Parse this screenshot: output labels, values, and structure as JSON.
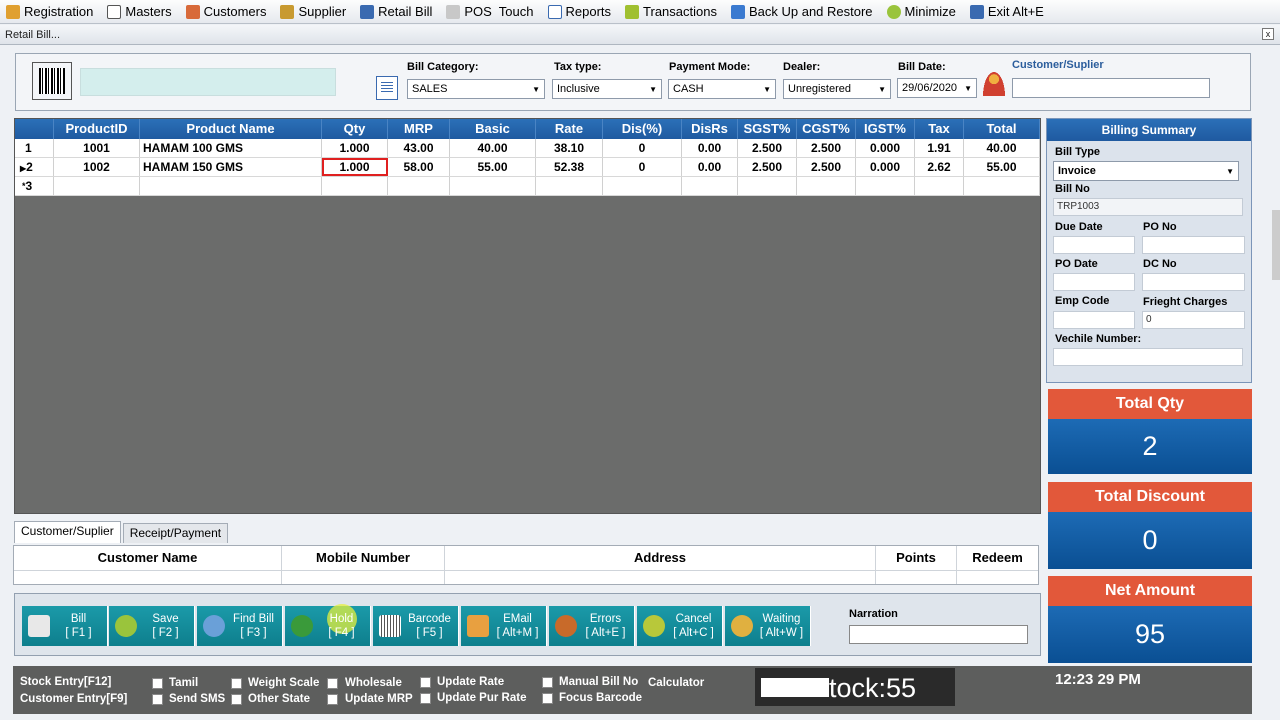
{
  "menu": [
    "Registration",
    "Masters",
    "Customers",
    "Supplier",
    "Retail Bill",
    "POS  Touch",
    "Reports",
    "Transactions",
    "Back Up and Restore",
    "Minimize",
    "Exit Alt+E"
  ],
  "window_title": "Retail Bill...",
  "close_glyph": "x",
  "fields": {
    "bill_category_label": "Bill Category:",
    "bill_category_value": "SALES",
    "tax_type_label": "Tax type:",
    "tax_type_value": "Inclusive",
    "payment_mode_label": "Payment Mode:",
    "payment_mode_value": "CASH",
    "dealer_label": "Dealer:",
    "dealer_value": "Unregistered",
    "bill_date_label": "Bill Date:",
    "bill_date_value": "29/06/2020",
    "customer_label": "Customer/Suplier",
    "customer_value": ""
  },
  "grid": {
    "columns": [
      "ProductID",
      "Product Name",
      "Qty",
      "MRP",
      "Basic",
      "Rate",
      "Dis(%)",
      "DisRs",
      "SGST%",
      "CGST%",
      "IGST%",
      "Tax",
      "Total"
    ],
    "rows": [
      {
        "num": "1",
        "cells": [
          "1001",
          "HAMAM 100 GMS",
          "1.000",
          "43.00",
          "40.00",
          "38.10",
          "0",
          "0.00",
          "2.500",
          "2.500",
          "0.000",
          "1.91",
          "40.00"
        ]
      },
      {
        "num": "2",
        "cells": [
          "1002",
          "HAMAM 150 GMS",
          "1.000",
          "58.00",
          "55.00",
          "52.38",
          "0",
          "0.00",
          "2.500",
          "2.500",
          "0.000",
          "2.62",
          "55.00"
        ]
      },
      {
        "num": "3",
        "cells": [
          "",
          "",
          "",
          "",
          "",
          "",
          "",
          "",
          "",
          "",
          "",
          "",
          ""
        ]
      }
    ]
  },
  "summary": {
    "title": "Billing Summary",
    "bill_type_label": "Bill Type",
    "bill_type_value": "Invoice",
    "bill_no_label": "Bill No",
    "bill_no_value": "TRP1003",
    "due_date_label": "Due Date",
    "po_no_label": "PO No",
    "po_date_label": "PO Date",
    "dc_no_label": "DC No",
    "emp_code_label": "Emp Code",
    "freight_label": "Frieght Charges",
    "freight_value": "0",
    "vehicle_label": "Vechile Number:"
  },
  "totals": {
    "qty_label": "Total Qty",
    "qty_value": "2",
    "discount_label": "Total Discount",
    "discount_value": "0",
    "net_label": "Net Amount",
    "net_value": "95"
  },
  "tabs": [
    "Customer/Suplier",
    "Receipt/Payment"
  ],
  "customer_table": {
    "columns": [
      "Customer Name",
      "Mobile Number",
      "Address",
      "Points",
      "Redeem"
    ]
  },
  "buttons": [
    {
      "label": "Bill",
      "key": "[ F1 ]",
      "color": "#e8e8e8"
    },
    {
      "label": "Save",
      "key": "[ F2 ]",
      "color": "#9ac43c"
    },
    {
      "label": "Find Bill",
      "key": "[ F3 ]",
      "color": "#6aa0d8"
    },
    {
      "label": "Hold",
      "key": "[ F4 ]",
      "color": "#3a9a3a"
    },
    {
      "label": "Barcode",
      "key": "[ F5 ]",
      "color": "#d0d0d0"
    },
    {
      "label": "EMail",
      "key": "[ Alt+M ]",
      "color": "#e8a040"
    },
    {
      "label": "Errors",
      "key": "[ Alt+E ]",
      "color": "#c86a2a"
    },
    {
      "label": "Cancel",
      "key": "[ Alt+C ]",
      "color": "#b8c83a"
    },
    {
      "label": "Waiting",
      "key": "[ Alt+W ]",
      "color": "#e0b040"
    }
  ],
  "narration_label": "Narration",
  "status": {
    "stock_entry": "Stock Entry[F12]",
    "customer_entry": "Customer Entry[F9]",
    "checks": [
      "Tamil",
      "Send SMS",
      "Weight Scale",
      "Other State",
      "Wholesale",
      "Update MRP",
      "Update Rate",
      "Update Pur Rate",
      "Manual Bill No",
      "Focus Barcode"
    ],
    "calculator": "Calculator",
    "stock_text": "tock:55",
    "clock": "12:23 29 PM"
  }
}
